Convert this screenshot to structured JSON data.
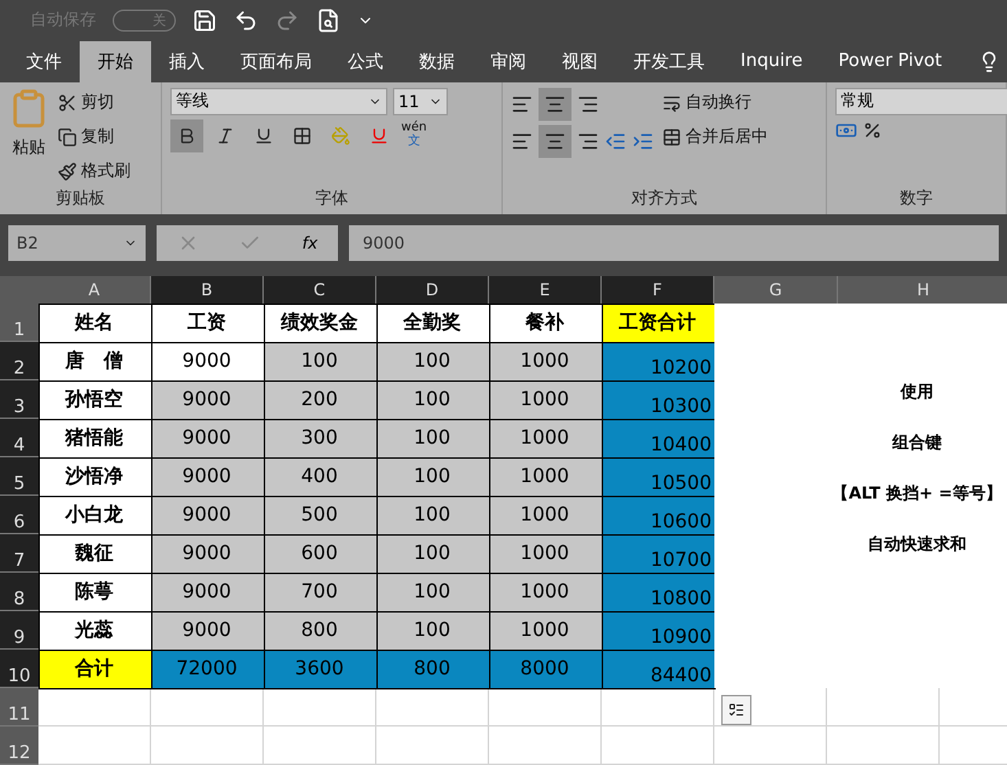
{
  "quick_access": {
    "autosave_label": "自动保存",
    "autosave_state": "关",
    "autosave_on": false
  },
  "tabs": [
    {
      "label": "文件",
      "selected": false
    },
    {
      "label": "开始",
      "selected": true
    },
    {
      "label": "插入",
      "selected": false
    },
    {
      "label": "页面布局",
      "selected": false
    },
    {
      "label": "公式",
      "selected": false
    },
    {
      "label": "数据",
      "selected": false
    },
    {
      "label": "审阅",
      "selected": false
    },
    {
      "label": "视图",
      "selected": false
    },
    {
      "label": "开发工具",
      "selected": false
    },
    {
      "label": "Inquire",
      "selected": false
    },
    {
      "label": "Power Pivot",
      "selected": false
    }
  ],
  "ribbon": {
    "clipboard": {
      "paste": "粘贴",
      "cut": "剪切",
      "copy": "复制",
      "format_painter": "格式刷",
      "group": "剪贴板"
    },
    "font": {
      "name": "等线",
      "size": "11",
      "phonetic": "wén",
      "phonetic_sub": "文",
      "group": "字体"
    },
    "alignment": {
      "wrap": "自动换行",
      "merge": "合并后居中",
      "group": "对齐方式"
    },
    "number": {
      "format": "常规",
      "group": "数字"
    }
  },
  "formula_bar": {
    "name_box": "B2",
    "value": "9000",
    "fx_label": "fx"
  },
  "columns": [
    {
      "label": "A",
      "selected": false
    },
    {
      "label": "B",
      "selected": true
    },
    {
      "label": "C",
      "selected": true
    },
    {
      "label": "D",
      "selected": true
    },
    {
      "label": "E",
      "selected": true
    },
    {
      "label": "F",
      "selected": true
    },
    {
      "label": "G",
      "selected": false
    },
    {
      "label": "H",
      "selected": false
    }
  ],
  "rows": [
    {
      "label": "1",
      "selected": false,
      "cells": [
        {
          "text": "姓名",
          "kind": "none"
        },
        {
          "text": "工资",
          "kind": "none"
        },
        {
          "text": "绩效奖金",
          "kind": "none"
        },
        {
          "text": "全勤奖",
          "kind": "none"
        },
        {
          "text": "餐补",
          "kind": "none"
        },
        {
          "text": "工资合计",
          "kind": "yellow"
        }
      ]
    },
    {
      "label": "2",
      "selected": true,
      "cells": [
        {
          "text": "唐　僧",
          "kind": "none"
        },
        {
          "text": "9000",
          "kind": "none"
        },
        {
          "text": "100",
          "kind": "grey"
        },
        {
          "text": "100",
          "kind": "grey"
        },
        {
          "text": "1000",
          "kind": "grey"
        },
        {
          "text": "10200",
          "kind": "blue"
        }
      ]
    },
    {
      "label": "3",
      "selected": true,
      "cells": [
        {
          "text": "孙悟空",
          "kind": "none"
        },
        {
          "text": "9000",
          "kind": "grey"
        },
        {
          "text": "200",
          "kind": "grey"
        },
        {
          "text": "100",
          "kind": "grey"
        },
        {
          "text": "1000",
          "kind": "grey"
        },
        {
          "text": "10300",
          "kind": "blue"
        }
      ]
    },
    {
      "label": "4",
      "selected": true,
      "cells": [
        {
          "text": "猪悟能",
          "kind": "none"
        },
        {
          "text": "9000",
          "kind": "grey"
        },
        {
          "text": "300",
          "kind": "grey"
        },
        {
          "text": "100",
          "kind": "grey"
        },
        {
          "text": "1000",
          "kind": "grey"
        },
        {
          "text": "10400",
          "kind": "blue"
        }
      ]
    },
    {
      "label": "5",
      "selected": true,
      "cells": [
        {
          "text": "沙悟净",
          "kind": "none"
        },
        {
          "text": "9000",
          "kind": "grey"
        },
        {
          "text": "400",
          "kind": "grey"
        },
        {
          "text": "100",
          "kind": "grey"
        },
        {
          "text": "1000",
          "kind": "grey"
        },
        {
          "text": "10500",
          "kind": "blue"
        }
      ]
    },
    {
      "label": "6",
      "selected": true,
      "cells": [
        {
          "text": "小白龙",
          "kind": "none"
        },
        {
          "text": "9000",
          "kind": "grey"
        },
        {
          "text": "500",
          "kind": "grey"
        },
        {
          "text": "100",
          "kind": "grey"
        },
        {
          "text": "1000",
          "kind": "grey"
        },
        {
          "text": "10600",
          "kind": "blue"
        }
      ]
    },
    {
      "label": "7",
      "selected": true,
      "cells": [
        {
          "text": "魏征",
          "kind": "none"
        },
        {
          "text": "9000",
          "kind": "grey"
        },
        {
          "text": "600",
          "kind": "grey"
        },
        {
          "text": "100",
          "kind": "grey"
        },
        {
          "text": "1000",
          "kind": "grey"
        },
        {
          "text": "10700",
          "kind": "blue"
        }
      ]
    },
    {
      "label": "8",
      "selected": true,
      "cells": [
        {
          "text": "陈萼",
          "kind": "none"
        },
        {
          "text": "9000",
          "kind": "grey"
        },
        {
          "text": "700",
          "kind": "grey"
        },
        {
          "text": "100",
          "kind": "grey"
        },
        {
          "text": "1000",
          "kind": "grey"
        },
        {
          "text": "10800",
          "kind": "blue"
        }
      ]
    },
    {
      "label": "9",
      "selected": true,
      "cells": [
        {
          "text": "光蕊",
          "kind": "none"
        },
        {
          "text": "9000",
          "kind": "grey"
        },
        {
          "text": "800",
          "kind": "grey"
        },
        {
          "text": "100",
          "kind": "grey"
        },
        {
          "text": "1000",
          "kind": "grey"
        },
        {
          "text": "10900",
          "kind": "blue"
        }
      ]
    },
    {
      "label": "10",
      "selected": true,
      "cells": [
        {
          "text": "合计",
          "kind": "yellow"
        },
        {
          "text": "72000",
          "kind": "blue"
        },
        {
          "text": "3600",
          "kind": "blue"
        },
        {
          "text": "800",
          "kind": "blue"
        },
        {
          "text": "8000",
          "kind": "blue"
        },
        {
          "text": "84400",
          "kind": "blue"
        }
      ]
    },
    {
      "label": "11",
      "selected": false,
      "cells": []
    },
    {
      "label": "12",
      "selected": false,
      "cells": []
    }
  ],
  "notes": [
    "使用",
    "组合键",
    "【ALT 换挡+ =等号】",
    "自动快速求和"
  ]
}
